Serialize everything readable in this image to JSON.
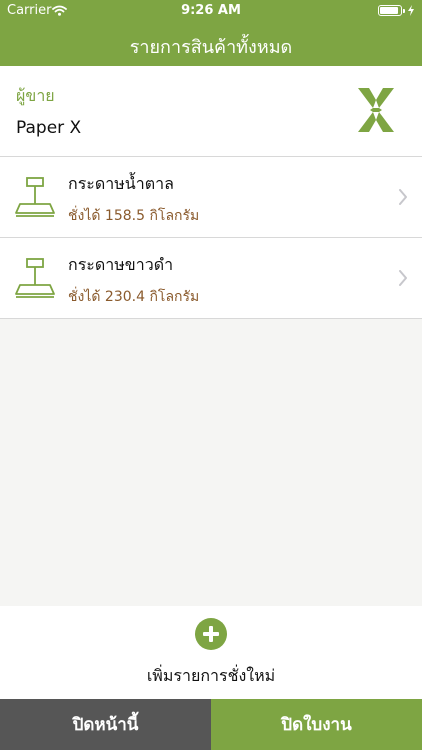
{
  "status_bar": {
    "carrier": "Carrier",
    "time": "9:26 AM",
    "battery_level": 0.9
  },
  "nav": {
    "title": "รายการสินค้าทั้งหมด"
  },
  "seller": {
    "label": "ผู้ขาย",
    "name": "Paper X"
  },
  "items": [
    {
      "name": "กระดาษน้ำตาล",
      "weight": "ชั่งได้ 158.5 กิโลกรัม"
    },
    {
      "name": "กระดาษขาวดำ",
      "weight": "ชั่งได้ 230.4 กิโลกรัม"
    }
  ],
  "add": {
    "label": "เพิ่มรายการชั่งใหม่"
  },
  "footer": {
    "close_page": "ปิดหน้านี้",
    "close_ticket": "ปิดใบงาน"
  },
  "colors": {
    "accent": "#7ea543",
    "dark": "#565656",
    "weight_text": "#8a5a2c"
  },
  "icons": {
    "wifi": "wifi-icon",
    "battery": "battery-icon",
    "logo": "paper-x-logo-icon",
    "scale": "scale-icon",
    "chevron": "chevron-right-icon",
    "add": "plus-icon"
  }
}
